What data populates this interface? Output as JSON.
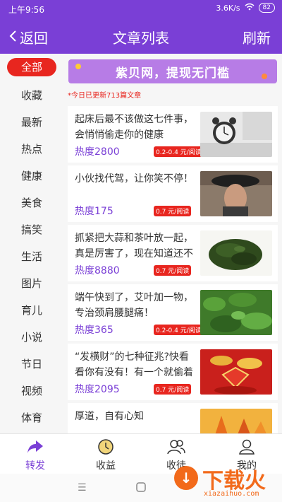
{
  "status_bar": {
    "time": "上午9:56",
    "network_speed": "3.6K/s",
    "battery": "82"
  },
  "header": {
    "back_label": "返回",
    "title": "文章列表",
    "refresh_label": "刷新"
  },
  "categories": [
    "全部",
    "收藏",
    "最新",
    "热点",
    "健康",
    "美食",
    "搞笑",
    "生活",
    "图片",
    "育儿",
    "小说",
    "节日",
    "视频",
    "体育"
  ],
  "banner": {
    "text": "紫贝网，提现无门槛"
  },
  "notice": "*今日已更新713篇文章",
  "articles": [
    {
      "title": "起床后最不该做这七件事，会悄悄偷走你的健康",
      "heat": "热度2800",
      "rate": "0.2-0.4 元/阅读",
      "image": "alarm-clock-image"
    },
    {
      "title": "小伙找代驾，让你笑不停！",
      "heat": "热度175",
      "rate": "0.7 元/阅读",
      "image": "person-hat-image"
    },
    {
      "title": "抓紧把大蒜和茶叶放一起，真是厉害了，现在知道还不晚",
      "heat": "热度8880",
      "rate": "0.7 元/阅读",
      "image": "tea-leaves-image"
    },
    {
      "title": "端午快到了，艾叶加一物，专治颈肩腰腿痛！",
      "heat": "热度365",
      "rate": "0.2-0.4 元/阅读",
      "image": "mugwort-image"
    },
    {
      "title": "“发横财”的七种征兆?快看看你有没有！有一个就偷着乐吧",
      "heat": "热度2095",
      "rate": "0.7 元/阅读",
      "image": "gold-ingot-image"
    },
    {
      "title": "厚道，自有心知",
      "heat": "",
      "rate": "",
      "image": "autumn-leaves-image"
    }
  ],
  "tabs": [
    {
      "label": "转发",
      "icon": "share-arrow-icon"
    },
    {
      "label": "收益",
      "icon": "coin-icon"
    },
    {
      "label": "收徒",
      "icon": "people-icon"
    },
    {
      "label": "我的",
      "icon": "user-icon"
    }
  ],
  "watermark": {
    "text": "下载火",
    "url": "xiazaihuo.com"
  },
  "colors": {
    "brand": "#7a3fd6",
    "accent": "#e8261f",
    "watermark": "#f26a1b"
  }
}
